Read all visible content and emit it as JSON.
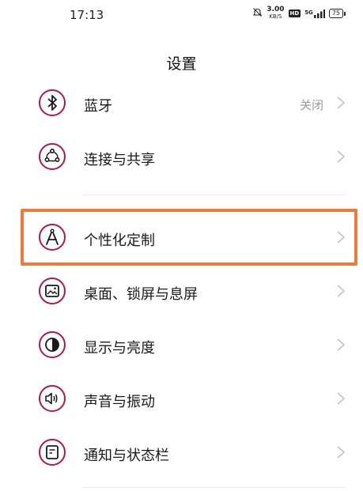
{
  "status_bar": {
    "time": "17:13",
    "net_speed_value": "3.00",
    "net_speed_unit": "KB/S",
    "hd_label": "HD",
    "signal_label": "5G",
    "battery_level": "75"
  },
  "header": {
    "title": "设置"
  },
  "settings": {
    "items": [
      {
        "label": "蓝牙",
        "value": "关闭",
        "icon": "bluetooth-icon"
      },
      {
        "label": "连接与共享",
        "icon": "share-icon"
      },
      {
        "label": "个性化定制",
        "icon": "personalization-icon"
      },
      {
        "label": "桌面、锁屏与息屏",
        "icon": "wallpaper-icon"
      },
      {
        "label": "显示与亮度",
        "icon": "brightness-icon"
      },
      {
        "label": "声音与振动",
        "icon": "sound-icon"
      },
      {
        "label": "通知与状态栏",
        "icon": "notification-icon"
      }
    ]
  },
  "colors": {
    "icon_accent": "#b0174a",
    "highlight_border": "#ee7a3a",
    "value_text": "#9a9a9a"
  }
}
